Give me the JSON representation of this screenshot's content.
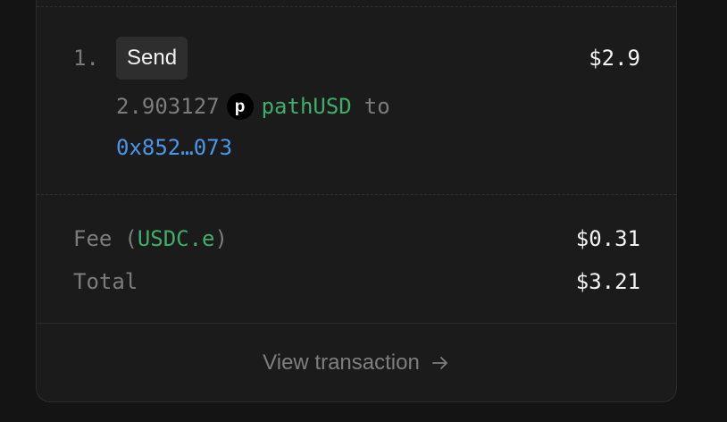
{
  "transfer": {
    "index": "1.",
    "action_label": "Send",
    "amount_usd": "$2.9",
    "token_amount": "2.903127",
    "token_icon_letter": "p",
    "token_name": "pathUSD",
    "to_word": "to",
    "recipient": "0x852…073"
  },
  "fee": {
    "label": "Fee",
    "paren_open": "(",
    "token": "USDC.e",
    "paren_close": ")",
    "value": "$0.31"
  },
  "total": {
    "label": "Total",
    "value": "$3.21"
  },
  "footer": {
    "view_label": "View transaction",
    "icon": "arrow-right-icon"
  },
  "colors": {
    "token_green": "#3fae6a",
    "address_blue": "#4c96e8",
    "muted": "#7c7c7c",
    "card_bg": "#1b1b1b",
    "page_bg": "#141414"
  }
}
